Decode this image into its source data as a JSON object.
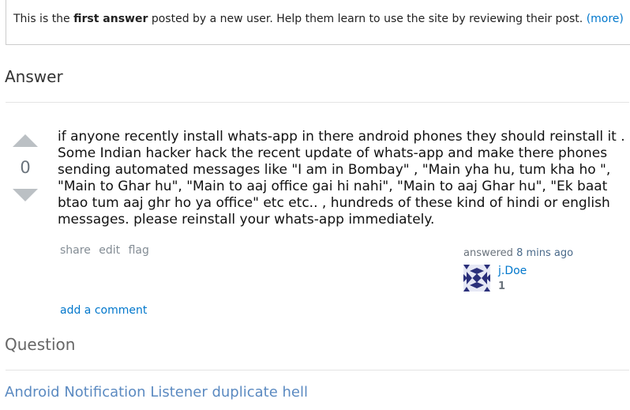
{
  "notice": {
    "prefix": "This is the ",
    "emphasis": "first answer",
    "suffix": " posted by a new user. Help them learn to use the site by reviewing their post. ",
    "more_label": "(more)"
  },
  "answer_section": {
    "title": "Answer"
  },
  "answer": {
    "vote_count": "0",
    "body": "if anyone recently install whats-app in there android phones they should reinstall it . Some Indian hacker hack the recent update of whats-app and make there phones sending automated messages like \"I am in Bombay\" , \"Main yha hu, tum kha ho \", \"Main to Ghar hu\", \"Main to aaj office gai hi nahi\", \"Main to aaj Ghar hu\", \"Ek baat btao tum aaj ghr ho ya office\" etc etc.. , hundreds of these kind of hindi or english messages. please reinstall your whats-app immediately.",
    "menu": {
      "share": "share",
      "edit": "edit",
      "flag": "flag"
    },
    "user_action": {
      "verb": "answered",
      "time": "8 mins ago"
    },
    "user": {
      "name": "j.Doe",
      "reputation": "1"
    },
    "add_comment_label": "add a comment"
  },
  "question_section": {
    "title": "Question",
    "question_title": "Android Notification Listener duplicate hell"
  },
  "colors": {
    "link": "#0077cc",
    "vote_arrow": "#bbc0c4",
    "avatar_pattern": "#2a2f7a"
  },
  "icons": {
    "upvote": "upvote-arrow-icon",
    "downvote": "downvote-arrow-icon",
    "avatar": "identicon-avatar"
  }
}
